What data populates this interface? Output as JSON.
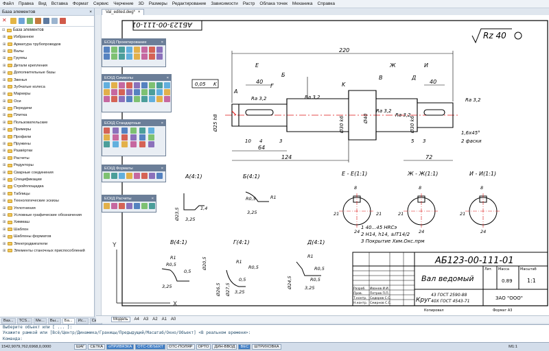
{
  "menu": [
    "Файл",
    "Правка",
    "Вид",
    "Вставка",
    "Формат",
    "Сервис",
    "Черчение",
    "3D",
    "Размеры",
    "Редактирование",
    "Зависимости",
    "Растр",
    "Облака точек",
    "Механика",
    "Справка"
  ],
  "left_panel": {
    "header": "База элементов",
    "close": "×",
    "tree_root": "База элементов",
    "tree_items": [
      "Избранное",
      "Арматура трубопроводов",
      "Валы",
      "Группы",
      "Детали крепления",
      "Дополнительные базы",
      "Звенья",
      "Зубчатые колеса",
      "Маркеры",
      "Оси",
      "Передачи",
      "Плитка",
      "Пользовательские",
      "Примеры",
      "Профили",
      "Пружины",
      "Развёртки",
      "Расчеты",
      "Редукторы",
      "Сварные соединения",
      "Спецификации",
      "Стройплощадка",
      "Таблицы",
      "Технологические эскизы",
      "Уплотнения",
      "Условные графические обозначения",
      "Химмаш",
      "Шаблон",
      "Шаблоны форматов",
      "Электродвигатели",
      "Элементы станочных приспособлений"
    ],
    "bottom_tabs": [
      "Ваз...",
      "TCS...",
      "Ме...",
      "Вы...",
      "Ба...",
      "Ис...",
      "Св..."
    ]
  },
  "document_tab": {
    "label": "Val_edited.dwg*",
    "close": "×"
  },
  "model_tabs": [
    "Модель",
    "А4",
    "А3",
    "А2",
    "А1",
    "А0"
  ],
  "panels": [
    {
      "title": "ЕСКД Проектирование"
    },
    {
      "title": "ЕСКД Символы"
    },
    {
      "title": "ЕСКД Стандартные"
    },
    {
      "title": "ЕСКД Форматы"
    },
    {
      "title": "ЕСКД Расчеты"
    }
  ],
  "drawing": {
    "stamp_top": "АБ123-00-111-01",
    "roughness": "Rz 40",
    "dims": {
      "d220": "220",
      "d124": "124",
      "d72": "72",
      "d64": "64",
      "d40a": "40",
      "d40b": "40",
      "d10": "10",
      "d5": "5",
      "d4": "4",
      "d3a": "3",
      "d3b": "3",
      "d25": "Ø25 h8",
      "d30": "Ø30 k6",
      "d40": "Ø40",
      "d30r": "Ø30 k6",
      "chamfer": "1,6x45°",
      "chamfer2": "2 фаски",
      "tol": "0,05",
      "tol_k": "K",
      "ra1": "Ra 3,2",
      "ra2": "Ra 3,2",
      "ra3": "Ra 3,2",
      "ra4": "Ra 3,2",
      "ra5": "Ra 3,2"
    },
    "letters": {
      "A": "A",
      "B": "Б",
      "C": "Г",
      "E": "E",
      "F": "Ж",
      "I": "И",
      "D": "Д",
      "B2": "В",
      "K": "K"
    },
    "views": {
      "a": "A(4:1)",
      "b": "Б(4:1)",
      "c": "E - E(1:1)",
      "d": "Ж - Ж(1:1)",
      "e": "И - И(1:1)",
      "f": "В(4:1)",
      "g": "Г(4:1)",
      "h": "Д(4:1)"
    },
    "view_dims": [
      "Ø23,5",
      "R0,5",
      "3,25",
      "R1",
      "1,4",
      "3,25",
      "R0,5",
      "0,5",
      "Ø20,5",
      "Ø26,5",
      "R1",
      "R0,5",
      "3,25",
      "Ø27,5",
      "R1",
      "R0,5",
      "3,25",
      "0,5",
      "Ø24,5",
      "R1",
      "R0,5",
      "3,25",
      "21",
      "8",
      "21",
      "8",
      "21",
      "8",
      "21",
      "24",
      "24",
      "24"
    ],
    "notes": [
      "1   40...45 HRCэ",
      "2   H14, h14, ±IT14/2",
      "3   Покрытие Хим.Окс.прм"
    ],
    "title_block": {
      "code": "АБ123-00-111-01",
      "name": "Вал ведомый",
      "material_line1": "Круг",
      "material_line2": "43 ГОСТ 2590-88",
      "material_line3": "40Х ГОСТ 4543-71",
      "mass": "0.89",
      "scale": "1:1",
      "company": "ЗАО \"ООО\"",
      "lit": "Лит.",
      "massh": "Масса",
      "scaleh": "Масштаб",
      "rows": [
        "Разраб.",
        "Пров.",
        "Т.контр.",
        "Н.контр.",
        "Утв."
      ],
      "people": [
        "Иванов И.И.",
        "Петров П.П.",
        "Сидоров С.С.",
        "Смирнов С.С.",
        "Кузнецов К.К."
      ],
      "copied": "Копировал",
      "format": "Формат   А3"
    }
  },
  "command": {
    "lines": [
      "Выберите объект или [ ... ]: ",
      "Укажите рамкой или [Всё/Центр/Динамика/Границы/Предыдущий/Масштаб/Окно/Объект] <В реальном времени>:",
      "Команда:"
    ]
  },
  "status": {
    "coords": "1542,9079,762,6968,0,0000",
    "buttons": [
      "ШАГ",
      "СЕТКА",
      "оПРИВЯЗКА",
      "ОТС-ОБЪЕКТ",
      "ОТС-ПОЛЯР",
      "ОРТО",
      "ДИН-ВВОД",
      "ВЕС",
      "ШТРИХОВКА"
    ],
    "scale": "M1:1"
  },
  "colors": {
    "accent": "#3e7cc4",
    "title": "#6b7e98",
    "red": "#d11",
    "folder": "#f1c75c"
  }
}
